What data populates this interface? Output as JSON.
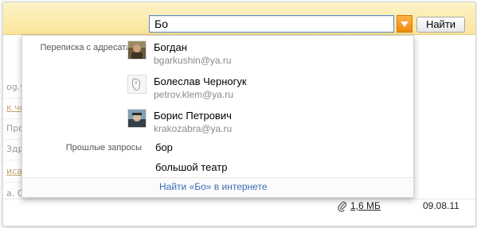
{
  "search": {
    "value": "Бо",
    "button_label": "Найти"
  },
  "suggest": {
    "contacts_label": "Переписка с адресатами",
    "contacts": [
      {
        "name": "Богдан",
        "email": "bgarkushin@ya.ru",
        "avatar": "photo-avatar"
      },
      {
        "name": "Болеслав Черногук",
        "email": "petrov.klem@ya.ru",
        "avatar": "default-avatar"
      },
      {
        "name": "Борис Петрович",
        "email": "krakozabra@ya.ru",
        "avatar": "photo-avatar"
      }
    ],
    "past_label": "Прошлые запросы",
    "past_queries": [
      "бор",
      "большой театр"
    ],
    "web_search": "Найти «Бо» в интернете"
  },
  "background": {
    "left_fragments": [
      "og.y",
      "к че",
      "Про",
      "Здр",
      "иса",
      "а. С"
    ]
  },
  "footer": {
    "attachment_size": "1,6 МБ",
    "date": "09.08.11"
  },
  "colors": {
    "accent_orange": "#f08a0c",
    "link_blue": "#3b6db3",
    "topbar_yellow": "#fbe59b"
  }
}
